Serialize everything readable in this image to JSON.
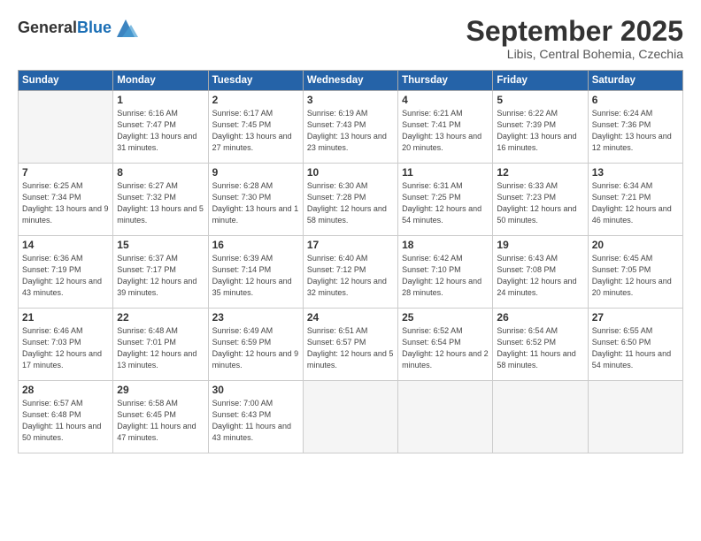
{
  "logo": {
    "general": "General",
    "blue": "Blue"
  },
  "header": {
    "month": "September 2025",
    "location": "Libis, Central Bohemia, Czechia"
  },
  "weekdays": [
    "Sunday",
    "Monday",
    "Tuesday",
    "Wednesday",
    "Thursday",
    "Friday",
    "Saturday"
  ],
  "weeks": [
    [
      {
        "day": "",
        "empty": true
      },
      {
        "day": "1",
        "sunrise": "6:16 AM",
        "sunset": "7:47 PM",
        "daylight": "13 hours and 31 minutes."
      },
      {
        "day": "2",
        "sunrise": "6:17 AM",
        "sunset": "7:45 PM",
        "daylight": "13 hours and 27 minutes."
      },
      {
        "day": "3",
        "sunrise": "6:19 AM",
        "sunset": "7:43 PM",
        "daylight": "13 hours and 23 minutes."
      },
      {
        "day": "4",
        "sunrise": "6:21 AM",
        "sunset": "7:41 PM",
        "daylight": "13 hours and 20 minutes."
      },
      {
        "day": "5",
        "sunrise": "6:22 AM",
        "sunset": "7:39 PM",
        "daylight": "13 hours and 16 minutes."
      },
      {
        "day": "6",
        "sunrise": "6:24 AM",
        "sunset": "7:36 PM",
        "daylight": "13 hours and 12 minutes."
      }
    ],
    [
      {
        "day": "7",
        "sunrise": "6:25 AM",
        "sunset": "7:34 PM",
        "daylight": "13 hours and 9 minutes."
      },
      {
        "day": "8",
        "sunrise": "6:27 AM",
        "sunset": "7:32 PM",
        "daylight": "13 hours and 5 minutes."
      },
      {
        "day": "9",
        "sunrise": "6:28 AM",
        "sunset": "7:30 PM",
        "daylight": "13 hours and 1 minute."
      },
      {
        "day": "10",
        "sunrise": "6:30 AM",
        "sunset": "7:28 PM",
        "daylight": "12 hours and 58 minutes."
      },
      {
        "day": "11",
        "sunrise": "6:31 AM",
        "sunset": "7:25 PM",
        "daylight": "12 hours and 54 minutes."
      },
      {
        "day": "12",
        "sunrise": "6:33 AM",
        "sunset": "7:23 PM",
        "daylight": "12 hours and 50 minutes."
      },
      {
        "day": "13",
        "sunrise": "6:34 AM",
        "sunset": "7:21 PM",
        "daylight": "12 hours and 46 minutes."
      }
    ],
    [
      {
        "day": "14",
        "sunrise": "6:36 AM",
        "sunset": "7:19 PM",
        "daylight": "12 hours and 43 minutes."
      },
      {
        "day": "15",
        "sunrise": "6:37 AM",
        "sunset": "7:17 PM",
        "daylight": "12 hours and 39 minutes."
      },
      {
        "day": "16",
        "sunrise": "6:39 AM",
        "sunset": "7:14 PM",
        "daylight": "12 hours and 35 minutes."
      },
      {
        "day": "17",
        "sunrise": "6:40 AM",
        "sunset": "7:12 PM",
        "daylight": "12 hours and 32 minutes."
      },
      {
        "day": "18",
        "sunrise": "6:42 AM",
        "sunset": "7:10 PM",
        "daylight": "12 hours and 28 minutes."
      },
      {
        "day": "19",
        "sunrise": "6:43 AM",
        "sunset": "7:08 PM",
        "daylight": "12 hours and 24 minutes."
      },
      {
        "day": "20",
        "sunrise": "6:45 AM",
        "sunset": "7:05 PM",
        "daylight": "12 hours and 20 minutes."
      }
    ],
    [
      {
        "day": "21",
        "sunrise": "6:46 AM",
        "sunset": "7:03 PM",
        "daylight": "12 hours and 17 minutes."
      },
      {
        "day": "22",
        "sunrise": "6:48 AM",
        "sunset": "7:01 PM",
        "daylight": "12 hours and 13 minutes."
      },
      {
        "day": "23",
        "sunrise": "6:49 AM",
        "sunset": "6:59 PM",
        "daylight": "12 hours and 9 minutes."
      },
      {
        "day": "24",
        "sunrise": "6:51 AM",
        "sunset": "6:57 PM",
        "daylight": "12 hours and 5 minutes."
      },
      {
        "day": "25",
        "sunrise": "6:52 AM",
        "sunset": "6:54 PM",
        "daylight": "12 hours and 2 minutes."
      },
      {
        "day": "26",
        "sunrise": "6:54 AM",
        "sunset": "6:52 PM",
        "daylight": "11 hours and 58 minutes."
      },
      {
        "day": "27",
        "sunrise": "6:55 AM",
        "sunset": "6:50 PM",
        "daylight": "11 hours and 54 minutes."
      }
    ],
    [
      {
        "day": "28",
        "sunrise": "6:57 AM",
        "sunset": "6:48 PM",
        "daylight": "11 hours and 50 minutes."
      },
      {
        "day": "29",
        "sunrise": "6:58 AM",
        "sunset": "6:45 PM",
        "daylight": "11 hours and 47 minutes."
      },
      {
        "day": "30",
        "sunrise": "7:00 AM",
        "sunset": "6:43 PM",
        "daylight": "11 hours and 43 minutes."
      },
      {
        "day": "",
        "empty": true
      },
      {
        "day": "",
        "empty": true
      },
      {
        "day": "",
        "empty": true
      },
      {
        "day": "",
        "empty": true
      }
    ]
  ]
}
